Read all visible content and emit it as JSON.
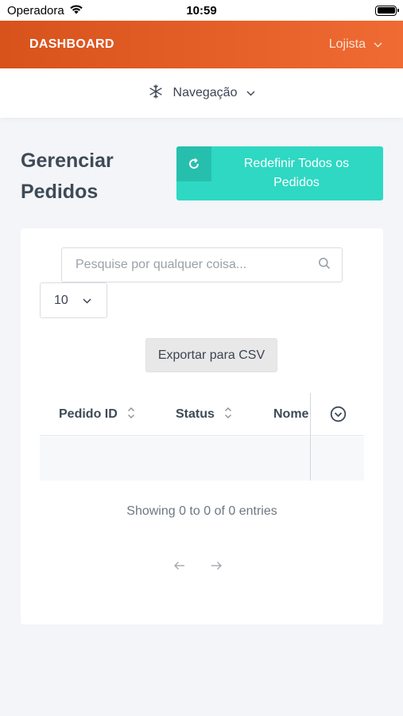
{
  "status_bar": {
    "carrier": "Operadora",
    "time": "10:59"
  },
  "header": {
    "brand": "DASHBOARD",
    "user_menu": "Lojista"
  },
  "nav": {
    "label": "Navegação"
  },
  "page": {
    "title": "Gerenciar Pedidos",
    "reset_button": "Redefinir Todos os Pedidos"
  },
  "table_controls": {
    "search_placeholder": "Pesquise por qualquer coisa...",
    "page_size": "10",
    "export_button": "Exportar para CSV"
  },
  "table": {
    "columns": [
      "Pedido ID",
      "Status",
      "Nome"
    ],
    "rows": []
  },
  "footer": {
    "info": "Showing 0 to 0 of 0 entries"
  },
  "colors": {
    "header_gradient_start": "#d8521c",
    "header_gradient_end": "#ef6b33",
    "accent_teal": "#2ed8c3",
    "accent_teal_dark": "#26bfad"
  },
  "icons": [
    "wifi-icon",
    "battery-icon",
    "chevron-down-icon",
    "navigation-snowflake-icon",
    "refresh-icon",
    "search-icon",
    "sort-icon",
    "column-toggle-icon",
    "arrow-left-icon",
    "arrow-right-icon"
  ]
}
